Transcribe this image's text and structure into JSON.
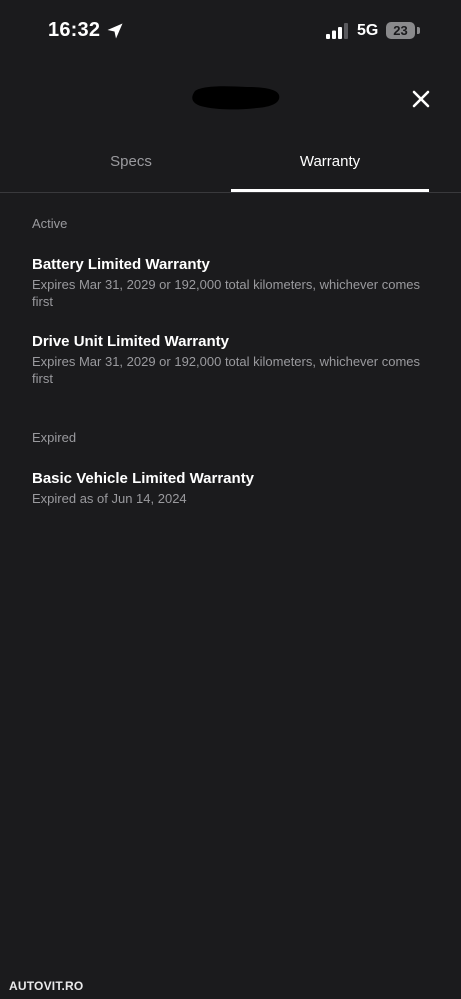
{
  "status_bar": {
    "time": "16:32",
    "network": "5G",
    "battery_level": "23",
    "icons": [
      "location-arrow-icon",
      "cellular-signal-icon",
      "battery-icon"
    ]
  },
  "header": {
    "close_icon": "close-icon"
  },
  "tabs": [
    {
      "label": "Specs",
      "selected": false
    },
    {
      "label": "Warranty",
      "selected": true
    }
  ],
  "sections": {
    "active": {
      "heading": "Active",
      "items": [
        {
          "title": "Battery Limited Warranty",
          "detail": "Expires Mar 31, 2029 or 192,000 total kilometers, whichever comes first"
        },
        {
          "title": "Drive Unit Limited Warranty",
          "detail": "Expires Mar 31, 2029 or 192,000 total kilometers, whichever comes first"
        }
      ]
    },
    "expired": {
      "heading": "Expired",
      "items": [
        {
          "title": "Basic Vehicle Limited Warranty",
          "detail": "Expired as of Jun 14, 2024"
        }
      ]
    }
  },
  "watermark": "AUTOVIT.RO",
  "colors": {
    "background": "#1b1b1d",
    "primary_text": "#ffffff",
    "secondary_text": "#9a9a9e",
    "divider": "#39393c"
  }
}
